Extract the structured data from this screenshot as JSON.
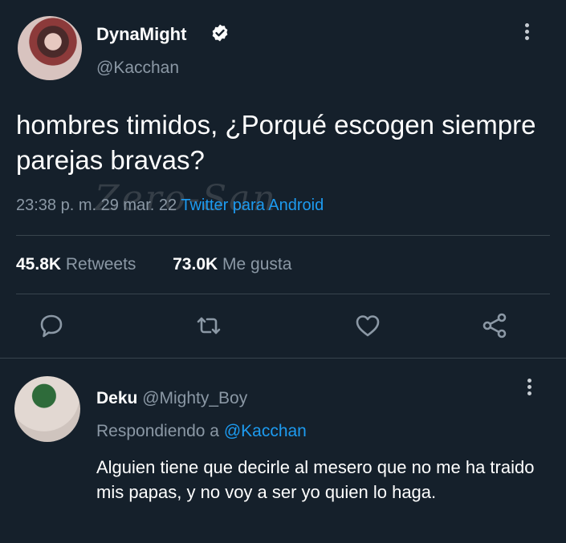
{
  "tweet": {
    "display_name": "DynaMight",
    "handle": "@Kacchan",
    "text": "hombres timidos, ¿Porqué escogen siempre parejas bravas?",
    "time": "23:38 p. m.",
    "date": "29 mar. 22",
    "source": "Twitter para Android",
    "watermark": "Zero-San",
    "retweets_count": "45.8K",
    "retweets_label": "Retweets",
    "likes_count": "73.0K",
    "likes_label": "Me gusta"
  },
  "reply": {
    "display_name": "Deku",
    "handle": "@Mighty_Boy",
    "replying_prefix": "Respondiendo a",
    "replying_to": "@Kacchan",
    "text": "Alguien tiene que decirle al mesero que no me ha traido mis papas, y no voy a ser yo quien lo haga."
  },
  "icons": {
    "verified": "verified-badge-icon",
    "more": "more-vertical-icon",
    "reply": "reply-icon",
    "retweet": "retweet-icon",
    "like": "heart-icon",
    "share": "share-icon"
  },
  "colors": {
    "background": "#15202b",
    "muted": "#8b98a5",
    "accent": "#1d9bf0",
    "divider": "#38444d"
  }
}
